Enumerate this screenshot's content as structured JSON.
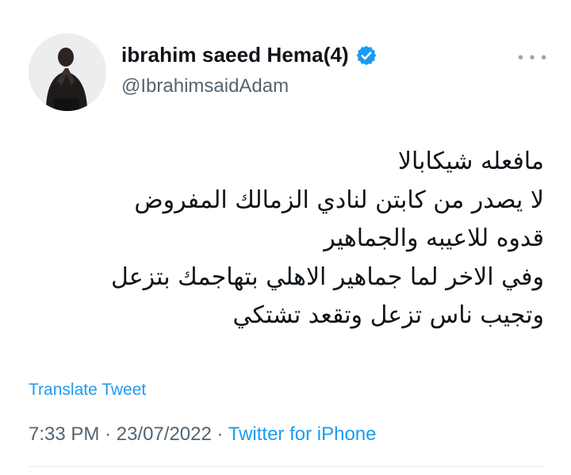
{
  "author": {
    "display_name": "ibrahim saeed Hema(4)",
    "handle": "@IbrahimsaidAdam",
    "verified": true,
    "avatar_icon": "person-praying-avatar"
  },
  "tweet": {
    "lines": [
      "مافعله شيكابالا",
      "لا يصدر من كابتن لنادي الزمالك المفروض",
      "قدوه للاعيبه والجماهير",
      "وفي الاخر لما جماهير الاهلي بتهاجمك بتزعل",
      "وتجيب ناس تزعل وتقعد تشتكي"
    ]
  },
  "translate_label": "Translate Tweet",
  "meta": {
    "time": "7:33 PM",
    "separator1": " · ",
    "date": "23/07/2022",
    "separator2": " · ",
    "source": "Twitter for iPhone"
  },
  "more_icon": "more-dots-icon",
  "colors": {
    "accent": "#1d9bf0",
    "text": "#0f1419",
    "secondary": "#536471"
  }
}
